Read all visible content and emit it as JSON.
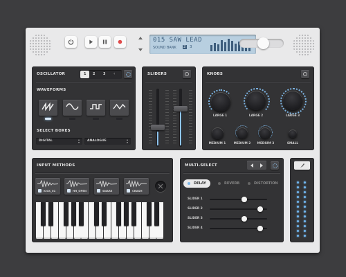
{
  "lcd": {
    "patch": "015 SAW LEAD",
    "bank_label": "SOUND BANK",
    "bank_num": "2",
    "bank_next": "3",
    "spectrum": [
      0.45,
      0.65,
      0.55,
      0.85,
      0.7,
      0.95,
      0.8,
      0.6,
      0.75,
      0.5,
      0.65,
      0.4
    ]
  },
  "transport": {
    "power_icon": "power-icon",
    "play_icon": "play-icon",
    "pause_icon": "pause-icon",
    "record_icon": "record-icon"
  },
  "volume": {
    "level": 0.55,
    "icon": "speaker-icon"
  },
  "oscillator": {
    "title": "OSCILLATOR",
    "tabs": [
      "1",
      "2",
      "3"
    ],
    "waveforms_title": "WAVEFORMS",
    "waveforms": [
      "sawtooth",
      "sine",
      "square",
      "triangle"
    ],
    "active_waveform": 0,
    "select_title": "SELECT BOXES",
    "selects": [
      "DIGITAL",
      "ANALOGUE"
    ]
  },
  "sliders": {
    "title": "SLIDERS",
    "levels": [
      0.6,
      0.22
    ]
  },
  "knobs": {
    "title": "KNOBS",
    "large": [
      "LARGE 1",
      "LARGE 2",
      "LARGE 3"
    ],
    "medium": [
      "MEDIUM 1",
      "MEDIUM 2",
      "MEDIUM 3"
    ],
    "small": "SMALL"
  },
  "input_methods": {
    "title": "INPUT METHODS",
    "pads": [
      "KICK_01",
      "HH_OPEN",
      "SNARE",
      "CRASH"
    ]
  },
  "multiselect": {
    "title": "MULTI-SELECT",
    "tabs": [
      "DELAY",
      "REVERB",
      "DISTORTION"
    ],
    "active_tab": 0,
    "sliders": [
      {
        "label": "SLIDER 1",
        "value": 0.6
      },
      {
        "label": "SLIDER 2",
        "value": 0.88
      },
      {
        "label": "SLIDER 3",
        "value": 0.6
      },
      {
        "label": "SLIDER 4",
        "value": 0.88
      }
    ]
  },
  "colors": {
    "accent": "#7fb8e8",
    "panel": "#333335",
    "body": "#e9e9ea",
    "record": "#e04a4a"
  }
}
